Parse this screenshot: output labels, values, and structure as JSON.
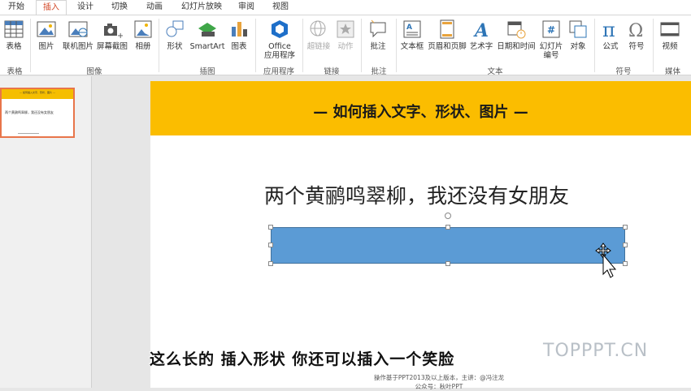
{
  "tabs": [
    {
      "label": "开始",
      "active": false
    },
    {
      "label": "插入",
      "active": true
    },
    {
      "label": "设计",
      "active": false
    },
    {
      "label": "切换",
      "active": false
    },
    {
      "label": "动画",
      "active": false
    },
    {
      "label": "幻灯片放映",
      "active": false
    },
    {
      "label": "审阅",
      "active": false
    },
    {
      "label": "视图",
      "active": false
    }
  ],
  "ribbon": {
    "buttons": {
      "table": "表格",
      "picture": "图片",
      "online_picture": "联机图片",
      "screenshot": "屏幕截图",
      "album": "相册",
      "shapes": "形状",
      "smartart": "SmartArt",
      "chart": "图表",
      "office_apps_1": "Office",
      "office_apps_2": "应用程序",
      "hyperlink": "超链接",
      "action": "动作",
      "comment": "批注",
      "textbox": "文本框",
      "header_footer": "页眉和页脚",
      "wordart": "艺术字",
      "datetime": "日期和时间",
      "slide_number_1": "幻灯片",
      "slide_number_2": "编号",
      "object": "对象",
      "equation": "公式",
      "symbol": "符号",
      "video": "视频"
    },
    "groups": {
      "tables": "表格",
      "images": "图像",
      "illustrations": "插图",
      "apps": "应用程序",
      "links": "链接",
      "comments": "批注",
      "text": "文本",
      "symbols": "符号",
      "media": "媒体"
    }
  },
  "thumbnail": {
    "title": "— 如何插入文字、形状、图片 —",
    "line": "两个黄鹂鸣翠柳，我还没有女朋友"
  },
  "slide": {
    "title": "— 如何插入文字、形状、图片 —",
    "text": "两个黄鹂鸣翠柳，我还没有女朋友",
    "shape_color": "#5b9bd5",
    "banner_color": "#fbbd00"
  },
  "overlay": {
    "subtitle": "这么长的  插入形状  你还可以插入一个笑脸",
    "watermark": "TOPPPT.CN",
    "footer_line1": "操作基于PPT2013及以上版本，主讲：@冯注龙",
    "footer_line2": "公众号：秋叶PPT"
  }
}
